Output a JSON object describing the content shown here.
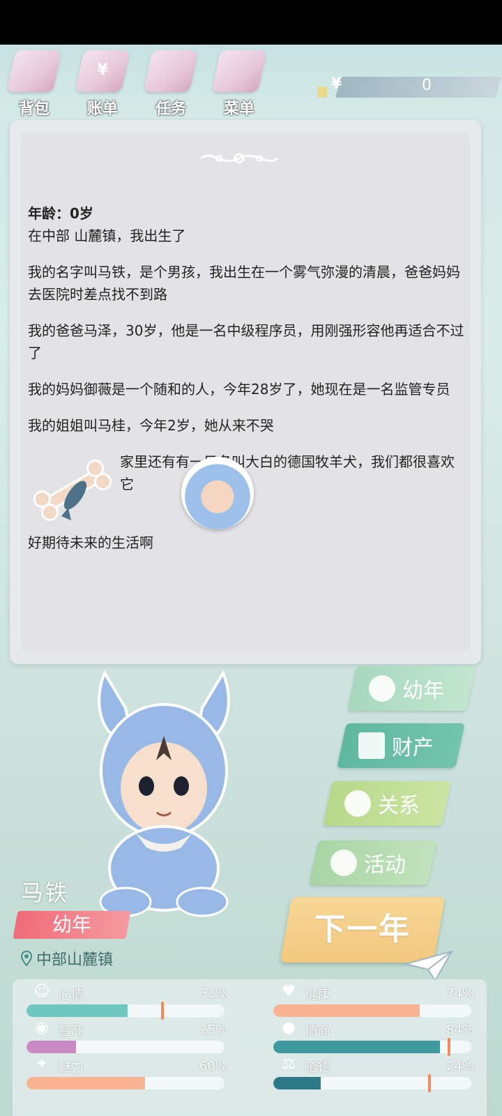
{
  "toolbar": {
    "items": [
      {
        "label": "背包",
        "icon": "bag-icon"
      },
      {
        "label": "账单",
        "icon": "bill-icon"
      },
      {
        "label": "任务",
        "icon": "task-icon"
      },
      {
        "label": "菜单",
        "icon": "menu-icon"
      }
    ],
    "currency_symbol": "¥",
    "money": "0"
  },
  "story": {
    "age_line": "年龄：0岁",
    "birth": "在中部 山麓镇，我出生了",
    "paragraphs": [
      "我的名字叫马铁，是个男孩，我出生在一个雾气弥漫的清晨，爸爸妈妈去医院时差点找不到路",
      "我的爸爸马泽，30岁，他是一名中级程序员，用刚强形容他再适合不过了",
      "我的妈妈御薇是一个随和的人，今年28岁了，她现在是一名监管专员",
      "我的姐姐叫马桂，今年2岁，她从来不哭"
    ],
    "pet_line": "家里还有有一只名叫大白的德国牧羊犬，我们都很喜欢它",
    "closing": "好期待未来的生活啊"
  },
  "menu": {
    "youth": "幼年",
    "assets": "财产",
    "relations": "关系",
    "activities": "活动",
    "next_year": "下一年"
  },
  "character": {
    "name": "马铁",
    "stage": "幼年",
    "location": "中部山麓镇"
  },
  "stats": [
    {
      "name": "心情",
      "value_text": "51%",
      "value": 0.51,
      "color": "#6fc7bf",
      "icon": "smile-icon"
    },
    {
      "name": "健康",
      "value_text": "74%",
      "value": 0.74,
      "color": "#f7b392",
      "icon": "heart-icon"
    },
    {
      "name": "智商",
      "value_text": "25%",
      "value": 0.25,
      "color": "#c989c3",
      "icon": "bulb-icon"
    },
    {
      "name": "情商",
      "value_text": "84%",
      "value": 0.84,
      "color": "#3f9a9f",
      "icon": "apple-icon"
    },
    {
      "name": "魅力",
      "value_text": "60%",
      "value": 0.6,
      "color": "#f7b392",
      "icon": "sparkle-icon"
    },
    {
      "name": "道德",
      "value_text": "24%",
      "value": 0.24,
      "color": "#2d7a86",
      "icon": "scale-icon"
    }
  ],
  "stat_markers": [
    0.68,
    null,
    null,
    0.88,
    null,
    0.78
  ]
}
